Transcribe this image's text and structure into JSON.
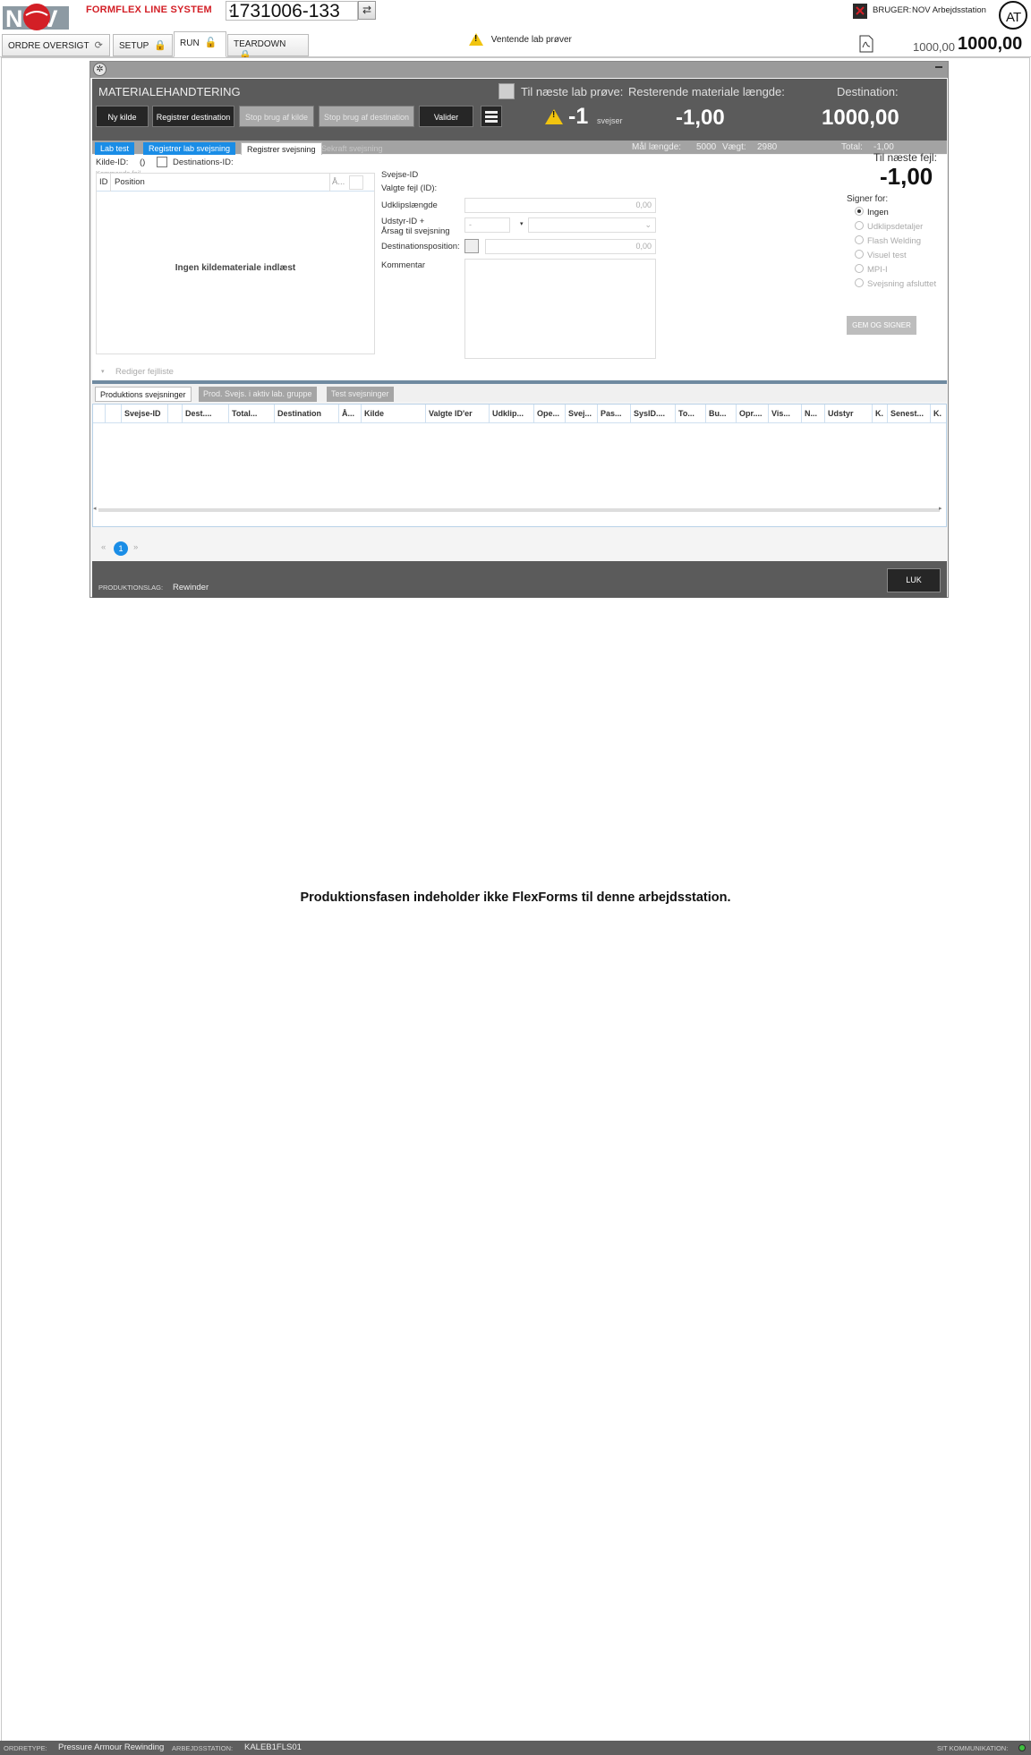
{
  "app": {
    "title": "FORMFLEX LINE SYSTEM",
    "order_number": "1731006-133",
    "user_label": "BRUGER:",
    "user_name": "NOV Arbejdsstation",
    "dest_small": "1000,00",
    "dest_big": "1000,00",
    "warning": "Ventende lab prøver"
  },
  "tabs": [
    {
      "label": "ORDRE OVERSIGT"
    },
    {
      "label": "SETUP"
    },
    {
      "label": "RUN"
    },
    {
      "label": "TEARDOWN"
    }
  ],
  "modal": {
    "title": "MATERIALEHANDTERING",
    "lab_label": "Til næste lab prøve:",
    "rest_label": "Resterende materiale længde:",
    "dest_label": "Destination:",
    "buttons": [
      "Ny kilde",
      "Registrer destination",
      "Stop brug af kilde",
      "Stop brug af destination",
      "Valider"
    ],
    "lab_value": "-1",
    "lab_unit": "svejser",
    "rest_value": "-1,00",
    "dest_value": "1000,00",
    "subtabs": [
      "Lab test",
      "Registrer lab svejsning",
      "Registrer svejsning",
      "Sekraft svejsning"
    ],
    "stat_maal_label": "Mål længde:",
    "stat_maal": "5000",
    "stat_vaegt_label": "Vægt:",
    "stat_vaegt": "2980",
    "stat_total_label": "Total:",
    "stat_total": "-1,00",
    "kilde_label": "Kilde-ID:",
    "kilde_value": "()",
    "dest_id_label": "Destinations-ID:",
    "kommende": "Kommende fejl",
    "grid_cols": [
      "ID",
      "Position",
      "Å..."
    ],
    "grid_empty": "Ingen kildemateriale indlæst",
    "rediger": "Rediger fejlliste",
    "svejse_id": "Svejse-ID",
    "valgte_fejl": "Valgte fejl (ID):",
    "udklip": "Udklipslængde",
    "udklip_value": "0,00",
    "udstyr": "Udstyr-ID +",
    "aarsag": "Årsag til svejsning",
    "udstyr_value": "-",
    "destpos": "Destinationsposition:",
    "destpos_value": "0,00",
    "kommentar": "Kommentar",
    "til_fejl_label": "Til næste fejl:",
    "til_fejl_value": "-1,00",
    "signer": "Signer for:",
    "radios": [
      "Ingen",
      "Udklipsdetaljer",
      "Flash Welding",
      "Visuel test",
      "MPI-I",
      "Svejsning afsluttet"
    ],
    "gem": "GEM OG SIGNER",
    "bottom_tabs": [
      "Produktions svejsninger",
      "Prod. Svejs. i aktiv lab. gruppe",
      "Test svejsninger"
    ],
    "cols": [
      "Svejse-ID",
      "Dest....",
      "Total...",
      "Destination",
      "Å...",
      "Kilde",
      "Valgte ID'er",
      "Udklip...",
      "Ope...",
      "Svej...",
      "Pas...",
      "SysID....",
      "To...",
      "Bu...",
      "Opr....",
      "Vis...",
      "N...",
      "Udstyr",
      "K.",
      "Senest...",
      "K."
    ],
    "page": "1",
    "footer_label": "PRODUKTIONSLAG:",
    "footer_value": "Rewinder",
    "luk": "LUK"
  },
  "message": "Produktionsfasen indeholder ikke FlexForms til denne arbejdsstation.",
  "status": {
    "ordretype_label": "ORDRETYPE:",
    "ordretype": "Pressure Armour Rewinding",
    "station_label": "ARBEJDSSTATION:",
    "station": "KALEB1FLS01",
    "sit_label": "SIT KOMMUNIKATION:"
  }
}
